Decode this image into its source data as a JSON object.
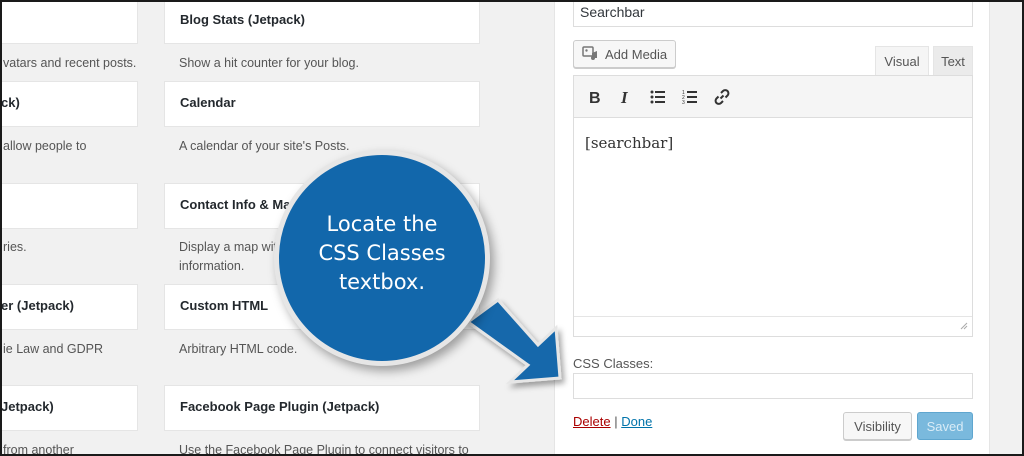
{
  "widgets_left": [
    {
      "title": "",
      "desc": [
        "vatars and recent posts."
      ]
    },
    {
      "title": "ck)",
      "desc": [
        "allow people to"
      ]
    },
    {
      "title": "",
      "desc": [
        "ries."
      ]
    },
    {
      "title": "er (Jetpack)",
      "desc": [
        "ie Law and GDPR"
      ]
    },
    {
      "title": "Jetpack)",
      "desc": [
        "from another"
      ]
    }
  ],
  "widgets_right": [
    {
      "title": "Blog Stats (Jetpack)",
      "desc": [
        "Show a hit counter for your blog."
      ]
    },
    {
      "title": "Calendar",
      "desc": [
        "A calendar of your site's Posts."
      ]
    },
    {
      "title": "Contact Info & Map",
      "desc": [
        "Display a map with",
        "information."
      ]
    },
    {
      "title": "Custom HTML",
      "desc": [
        "Arbitrary HTML code."
      ]
    },
    {
      "title": "Facebook Page Plugin (Jetpack)",
      "desc": [
        "Use the Facebook Page Plugin to connect visitors to"
      ]
    }
  ],
  "editor": {
    "title_value": "Searchbar",
    "add_media_label": "Add Media",
    "tab_visual": "Visual",
    "tab_text": "Text",
    "content": "[searchbar]",
    "css_label": "CSS Classes:",
    "css_value": "",
    "delete_label": "Delete",
    "separator": "|",
    "done_label": "Done",
    "visibility_label": "Visibility",
    "saved_label": "Saved"
  },
  "callout": {
    "lines": [
      "Locate the",
      "CSS Classes",
      "textbox."
    ],
    "color": "#1267ab"
  },
  "toolbar_icons": [
    "bold-icon",
    "italic-icon",
    "bullet-list-icon",
    "numbered-list-icon",
    "link-icon"
  ]
}
